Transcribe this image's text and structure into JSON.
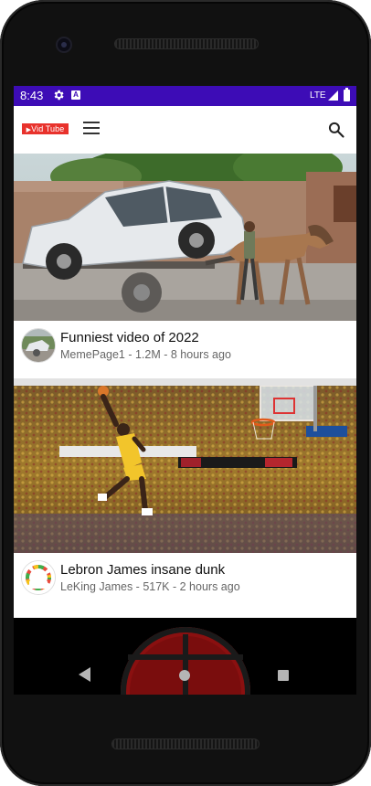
{
  "status_bar": {
    "time": "8:43",
    "network": "LTE",
    "icons": [
      "gear-icon",
      "a-notification-icon",
      "signal-icon",
      "battery-icon"
    ]
  },
  "app_bar": {
    "logo_text": "Vid Tube",
    "icons": [
      "menu-icon",
      "search-icon"
    ]
  },
  "videos": [
    {
      "title": "Funniest video of 2022",
      "meta": "MemePage1 - 1.2M - 8 hours ago"
    },
    {
      "title": "Lebron James insane dunk",
      "meta": "LeKing James - 517K - 2 hours ago"
    }
  ],
  "colors": {
    "status_bar": "#3d0cb6",
    "logo": "#e8322c"
  }
}
